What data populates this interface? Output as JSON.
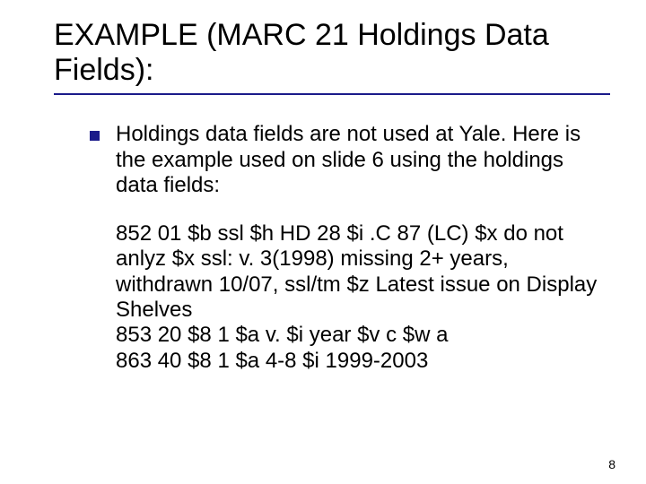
{
  "title": "EXAMPLE (MARC 21 Holdings Data Fields):",
  "bullet1": "Holdings data fields are not used at Yale. Here is the example used on slide 6 using the holdings data fields:",
  "code": "852 01 $b ssl $h HD 28 $i .C 87 (LC) $x do not anlyz $x ssl: v. 3(1998) missing 2+ years, withdrawn 10/07, ssl/tm $z Latest issue on Display Shelves\n853 20 $8 1 $a v. $i year $v c $w a\n863 40 $8 1 $a 4-8 $i 1999-2003",
  "page_number": "8"
}
